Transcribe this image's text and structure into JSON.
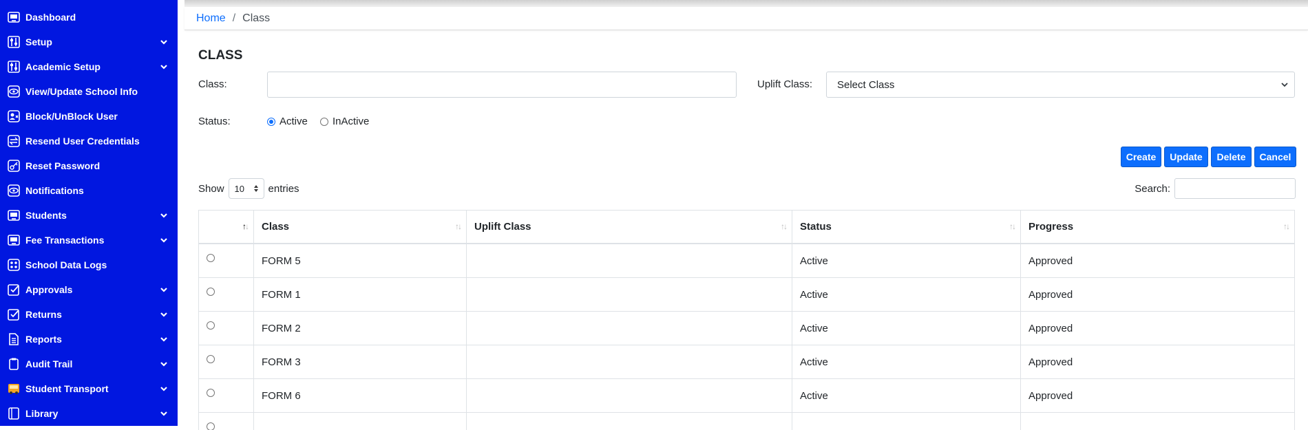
{
  "sidebar": {
    "items": [
      {
        "label": "Dashboard",
        "icon": "monitor-icon",
        "has_submenu": false
      },
      {
        "label": "Setup",
        "icon": "sliders-icon",
        "has_submenu": true
      },
      {
        "label": "Academic Setup",
        "icon": "sliders-icon",
        "has_submenu": true
      },
      {
        "label": "View/Update School Info",
        "icon": "eye-icon",
        "has_submenu": false
      },
      {
        "label": "Block/UnBlock User",
        "icon": "user-block-icon",
        "has_submenu": false
      },
      {
        "label": "Resend User Credentials",
        "icon": "resend-icon",
        "has_submenu": false
      },
      {
        "label": "Reset Password",
        "icon": "key-icon",
        "has_submenu": false
      },
      {
        "label": "Notifications",
        "icon": "eye-icon",
        "has_submenu": false
      },
      {
        "label": "Students",
        "icon": "monitor-icon",
        "has_submenu": true
      },
      {
        "label": "Fee Transactions",
        "icon": "monitor-icon",
        "has_submenu": true
      },
      {
        "label": "School Data Logs",
        "icon": "logs-icon",
        "has_submenu": false
      },
      {
        "label": "Approvals",
        "icon": "checkbox-icon",
        "has_submenu": true
      },
      {
        "label": "Returns",
        "icon": "checkbox-icon",
        "has_submenu": true
      },
      {
        "label": "Reports",
        "icon": "document-icon",
        "has_submenu": true
      },
      {
        "label": "Audit Trail",
        "icon": "clipboard-icon",
        "has_submenu": true
      },
      {
        "label": "Student Transport",
        "icon": "bus-icon",
        "has_submenu": true
      },
      {
        "label": "Library",
        "icon": "book-icon",
        "has_submenu": true
      }
    ]
  },
  "breadcrumb": {
    "home": "Home",
    "separator": "/",
    "current": "Class"
  },
  "page": {
    "title": "CLASS"
  },
  "form": {
    "class_label": "Class:",
    "class_value": "",
    "uplift_label": "Uplift Class:",
    "uplift_selected": "Select Class",
    "status_label": "Status:",
    "status_options": [
      {
        "label": "Active",
        "checked": true
      },
      {
        "label": "InActive",
        "checked": false
      }
    ]
  },
  "actions": {
    "create": "Create",
    "update": "Update",
    "delete": "Delete",
    "cancel": "Cancel"
  },
  "table_controls": {
    "show_label": "Show",
    "page_size": "10",
    "entries_label": "entries",
    "search_label": "Search:",
    "search_value": ""
  },
  "table": {
    "columns": [
      "",
      "Class",
      "Uplift Class",
      "Status",
      "Progress"
    ],
    "rows": [
      {
        "class": "FORM 5",
        "uplift": "",
        "status": "Active",
        "progress": "Approved"
      },
      {
        "class": "FORM 1",
        "uplift": "",
        "status": "Active",
        "progress": "Approved"
      },
      {
        "class": "FORM 2",
        "uplift": "",
        "status": "Active",
        "progress": "Approved"
      },
      {
        "class": "FORM 3",
        "uplift": "",
        "status": "Active",
        "progress": "Approved"
      },
      {
        "class": "FORM 6",
        "uplift": "",
        "status": "Active",
        "progress": "Approved"
      },
      {
        "class": "",
        "uplift": "",
        "status": "",
        "progress": ""
      }
    ]
  },
  "colors": {
    "sidebar_bg": "#0117e0",
    "accent": "#0d6efd"
  }
}
